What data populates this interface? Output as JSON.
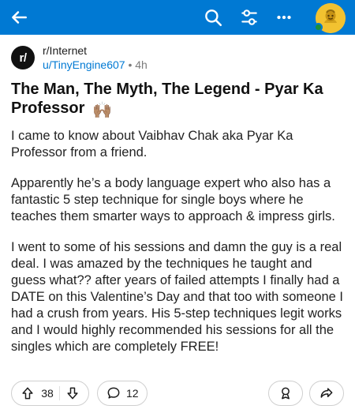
{
  "topbar": {
    "color": "#0079d3",
    "icons": [
      "back-arrow-icon",
      "search-icon",
      "filters-icon",
      "more-icon",
      "avatar-icon"
    ]
  },
  "post": {
    "subreddit": "r/Internet",
    "sub_avatar_text": "r/",
    "author": "u/TinyEngine607",
    "separator": " • ",
    "age": "4h",
    "title": "The Man, The Myth, The Legend - Pyar Ka Professor",
    "title_emoji": "🙌🏽",
    "body": [
      "I came to know about Vaibhav Chak aka Pyar Ka Professor from a friend.",
      "Apparently he’s a body language expert who also has a fantastic 5 step technique for single boys where he teaches them smarter ways to approach & impress girls.",
      "I went to some of his sessions and damn the guy is a real deal. I was amazed by the techniques he taught and guess what?? after years of failed attempts I finally had a DATE on this Valentine’s Day and that too with someone I had a crush from years. His 5-step techniques legit works and I would highly recommended his sessions for all the singles which are completely FREE!"
    ]
  },
  "actions": {
    "upvotes": "38",
    "comments": "12"
  }
}
